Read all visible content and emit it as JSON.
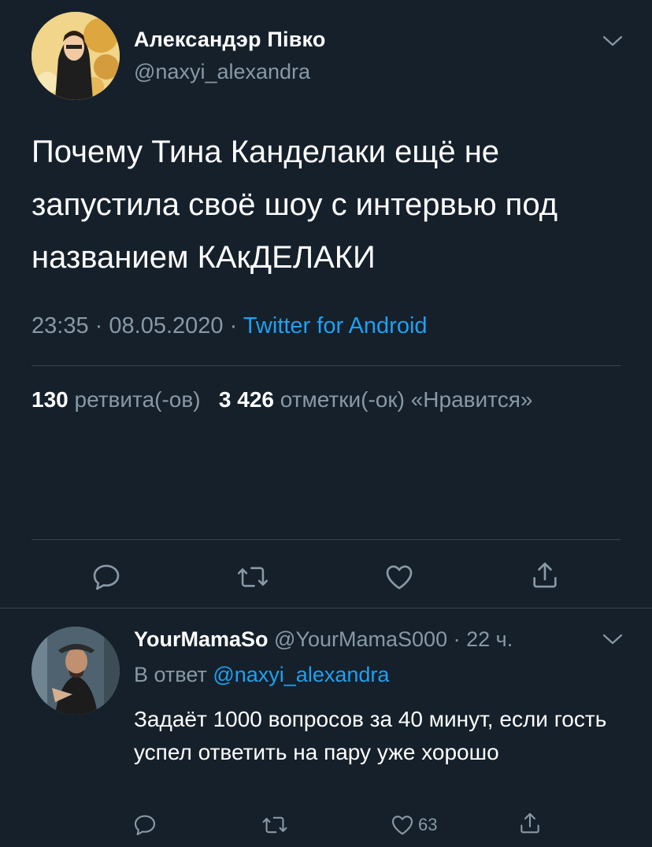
{
  "tweet": {
    "author_name": "Александэр Півко",
    "author_handle": "@naxyi_alexandra",
    "text": "Почему Тина Канделаки ещё не запустила своё шоу с интервью под названием КАкДЕЛАКИ",
    "time": "23:35",
    "date": "08.05.2020",
    "separator": "·",
    "source": "Twitter for Android",
    "retweets_count": "130",
    "retweets_label": "ретвита(-ов)",
    "likes_count": "3 426",
    "likes_label": "отметки(-ок) «Нравится»"
  },
  "reply": {
    "author_name": "YourMamaSo",
    "author_handle": "@YourMamaS000",
    "separator": "·",
    "time_ago": "22 ч.",
    "reply_prefix": "В ответ",
    "reply_to": "@naxyi_alexandra",
    "text": "Задаёт 1000 вопросов за 40 минут, если гость успел ответить на пару уже хорошо",
    "like_count": "63"
  },
  "icons": {
    "reply": "reply-icon",
    "retweet": "retweet-icon",
    "like": "heart-icon",
    "share": "share-icon",
    "more": "chevron-down-icon"
  },
  "colors": {
    "background": "#15202b",
    "text": "#ffffff",
    "secondary": "#8899a6",
    "link": "#1da1f2",
    "divider": "#38444d"
  }
}
